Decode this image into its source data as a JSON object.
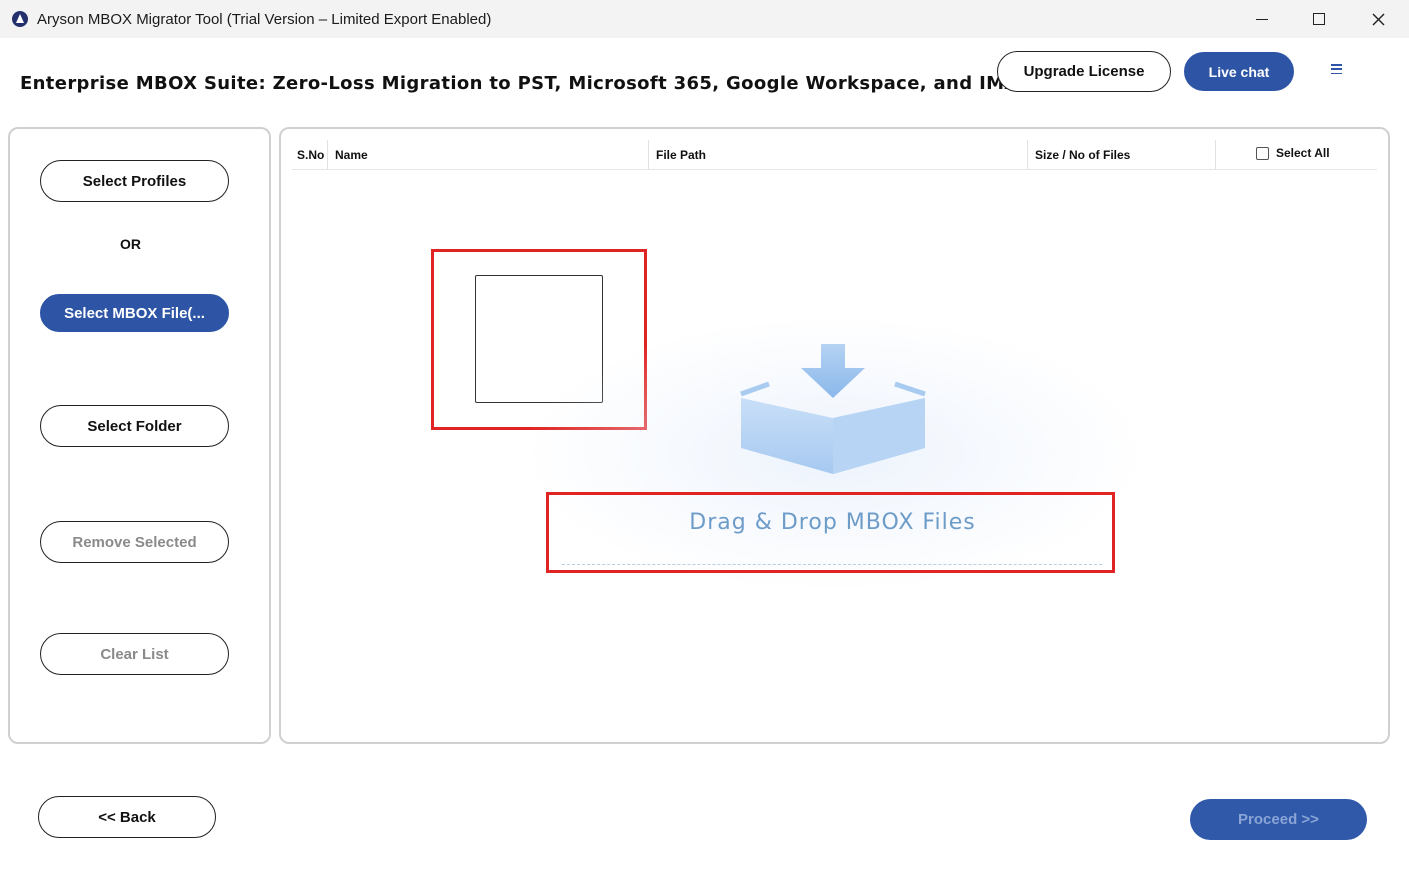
{
  "window": {
    "title": "Aryson MBOX Migrator Tool (Trial Version – Limited Export Enabled)",
    "icon": "aryson-logo-icon",
    "controls": [
      "minimize-icon",
      "maximize-icon",
      "close-icon"
    ]
  },
  "header": {
    "headline": "Enterprise MBOX Suite: Zero-Loss Migration to PST, Microsoft 365, Google Workspace, and IMAP.",
    "upgrade_label": "Upgrade License",
    "live_chat_label": "Live chat",
    "menu_icon": "hamburger-menu-icon"
  },
  "sidebar": {
    "select_profiles": "Select Profiles",
    "or_text": "OR",
    "select_mbox_files": "Select MBOX File(...",
    "select_folder": "Select Folder",
    "remove_selected": "Remove Selected",
    "clear_list": "Clear List"
  },
  "table": {
    "columns": [
      "S.No",
      "Name",
      "File Path",
      "Size / No of Files"
    ],
    "select_all_label": "Select All",
    "select_all_checked": false,
    "rows": []
  },
  "dropzone": {
    "label": "Drag & Drop MBOX Files",
    "icon": "download-box-icon"
  },
  "footer": {
    "back_label": "<< Back",
    "proceed_label": "Proceed >>"
  },
  "colors": {
    "accent": "#2e55a5",
    "highlight": "#e02323",
    "dropzone_text": "#6e9cc9"
  }
}
